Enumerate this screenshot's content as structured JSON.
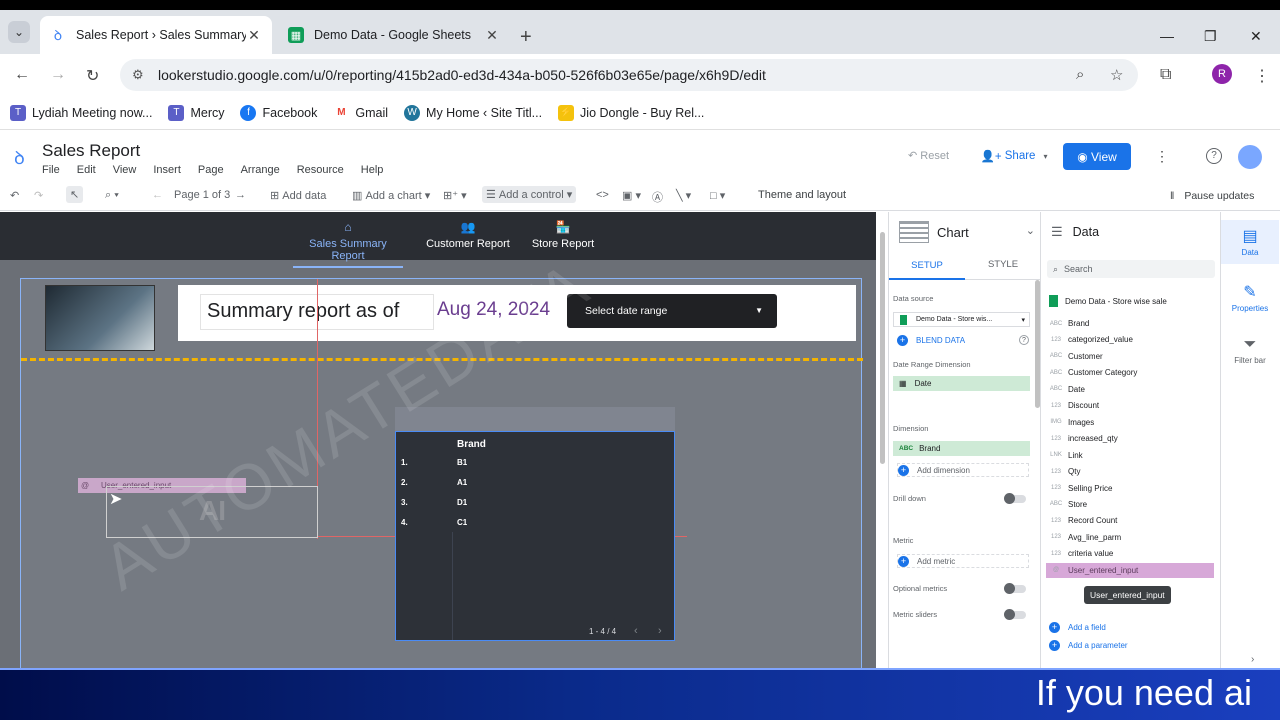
{
  "browser": {
    "tabs": [
      {
        "title": "Sales Report › Sales Summary R",
        "close": "✕"
      },
      {
        "title": "Demo Data - Google Sheets",
        "close": "✕"
      }
    ],
    "new_tab": "+",
    "url": "lookerstudio.google.com/u/0/reporting/415b2ad0-ed3d-434a-b050-526f6b03e65e/page/x6h9D/edit",
    "profile_letter": "R",
    "bookmarks": [
      "Lydiah Meeting now...",
      "Mercy",
      "Facebook",
      "Gmail",
      "My Home ‹ Site Titl...",
      "Jio Dongle - Buy Rel..."
    ]
  },
  "app": {
    "title": "Sales Report",
    "menu": [
      "File",
      "Edit",
      "View",
      "Insert",
      "Page",
      "Arrange",
      "Resource",
      "Help"
    ],
    "reset": "Reset",
    "share": "Share",
    "view": "View"
  },
  "toolbar": {
    "page_indicator": "Page 1 of 3",
    "add_data": "Add data",
    "add_chart": "Add a chart",
    "add_control": "Add a control",
    "theme": "Theme and layout",
    "pause": "Pause updates"
  },
  "report": {
    "nav": [
      "Sales Summary Report",
      "Customer Report",
      "Store Report"
    ],
    "summary_label": "Summary report as  of",
    "date_value": "Aug 24, 2024",
    "date_range": "Select date range",
    "control_label": "User_entered_input",
    "ai_text": "AI",
    "table": {
      "header": "Brand",
      "rows": [
        {
          "n": "1.",
          "v": "B1"
        },
        {
          "n": "2.",
          "v": "A1"
        },
        {
          "n": "3.",
          "v": "D1"
        },
        {
          "n": "4.",
          "v": "C1"
        }
      ],
      "pager": "1 - 4 / 4"
    },
    "watermark": "AUTOMATEDATA"
  },
  "chart_panel": {
    "title": "Chart",
    "tabs": [
      "SETUP",
      "STYLE"
    ],
    "data_source_label": "Data source",
    "data_source": "Demo Data - Store wis...",
    "blend": "BLEND DATA",
    "date_range_label": "Date Range Dimension",
    "date_field": "Date",
    "dimension_label": "Dimension",
    "dimension_field": "Brand",
    "dimension_type": "ABC",
    "add_dimension": "Add dimension",
    "drill_down": "Drill down",
    "metric_label": "Metric",
    "add_metric": "Add metric",
    "optional_metrics": "Optional metrics",
    "metric_sliders": "Metric sliders"
  },
  "data_panel": {
    "title": "Data",
    "search": "Search",
    "source": "Demo Data - Store wise sale",
    "fields": [
      {
        "type": "ABC",
        "name": "Brand"
      },
      {
        "type": "123",
        "name": "categorized_value"
      },
      {
        "type": "ABC",
        "name": "Customer"
      },
      {
        "type": "ABC",
        "name": "Customer Category"
      },
      {
        "type": "ABC",
        "name": "Date"
      },
      {
        "type": "123",
        "name": "Discount"
      },
      {
        "type": "IMG",
        "name": "Images"
      },
      {
        "type": "123",
        "name": "increased_qty"
      },
      {
        "type": "LNK",
        "name": "Link"
      },
      {
        "type": "123",
        "name": "Qty"
      },
      {
        "type": "123",
        "name": "Selling Price"
      },
      {
        "type": "ABC",
        "name": "Store"
      },
      {
        "type": "123",
        "name": "Record Count"
      },
      {
        "type": "123",
        "name": "Avg_line_parm"
      },
      {
        "type": "123",
        "name": "criteria value"
      },
      {
        "type": "@",
        "name": "User_entered_input"
      }
    ],
    "tooltip": "User_entered_input",
    "add_field": "Add a field",
    "add_parameter": "Add a parameter"
  },
  "rail": [
    "Data",
    "Properties",
    "Filter bar"
  ],
  "subtitle": "If you need ai"
}
